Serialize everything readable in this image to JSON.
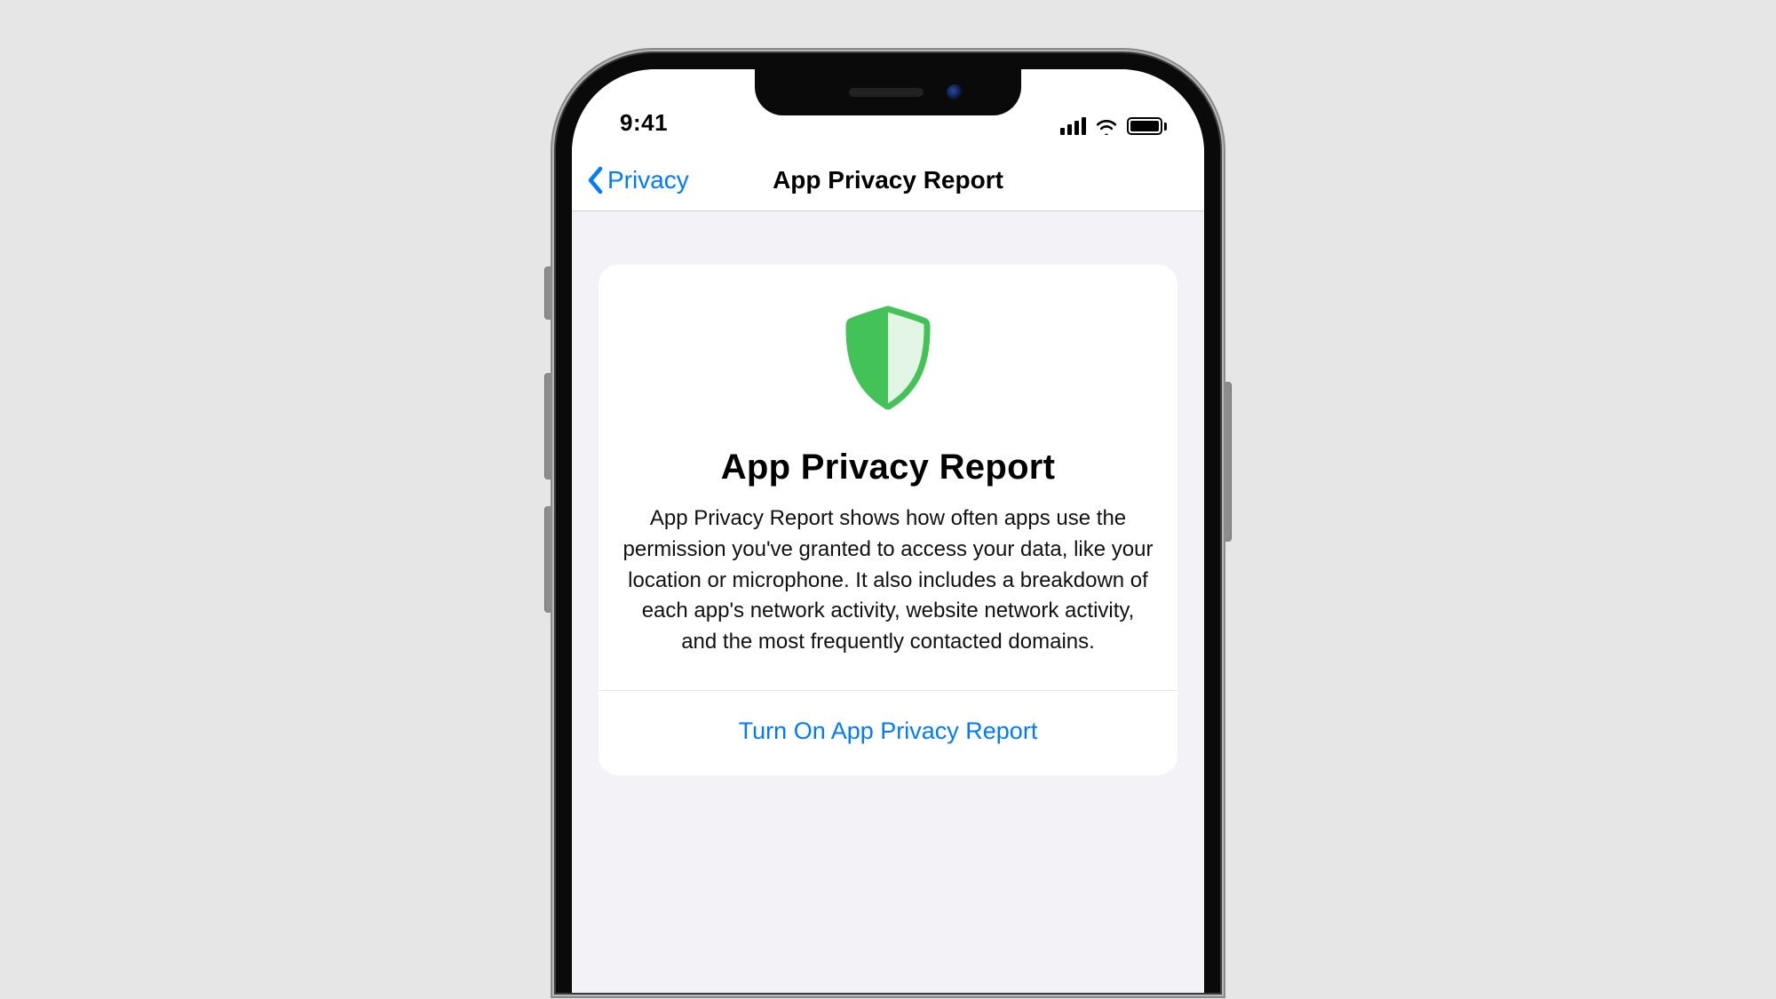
{
  "colors": {
    "accent": "#007aff",
    "shield_green": "#43c257",
    "page_bg": "#e6e6e6",
    "screen_bg": "#f2f2f7"
  },
  "status_bar": {
    "time": "9:41"
  },
  "nav": {
    "back_label": "Privacy",
    "title": "App Privacy Report"
  },
  "card": {
    "icon": "shield-icon",
    "heading": "App Privacy Report",
    "description": "App Privacy Report shows how often apps use the permission you've granted to access your data, like your location or microphone. It also includes a breakdown of each app's network activity, website network activity, and the most frequently contacted domains.",
    "turn_on_label": "Turn On App Privacy Report"
  }
}
